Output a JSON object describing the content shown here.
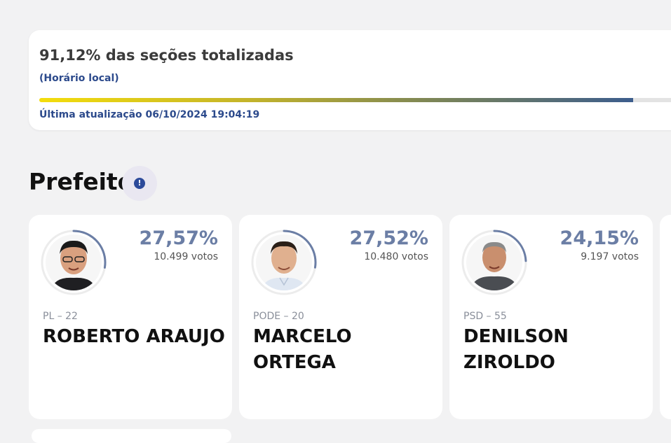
{
  "status": {
    "title": "91,12% das seções totalizadas",
    "subtitle": "(Horário local)",
    "progress": 0.9112,
    "updated": "Última atualização 06/10/2024 19:04:19"
  },
  "section": {
    "title": "Prefeito",
    "info_icon": "info-icon",
    "info_glyph": "!"
  },
  "candidates": [
    {
      "party": "PL – 22",
      "name": "ROBERTO ARAUJO",
      "percent": "27,57%",
      "votes": "10.499 votos",
      "share": 0.2757,
      "shirt": "#1f1f22",
      "hair": "#1a1a1a"
    },
    {
      "party": "PODE – 20",
      "name": "MARCELO ORTEGA",
      "percent": "27,52%",
      "votes": "10.480 votos",
      "share": 0.2752,
      "shirt": "#dfe7f2",
      "hair": "#2a1f18"
    },
    {
      "party": "PSD – 55",
      "name": "DENILSON ZIROLDO",
      "percent": "24,15%",
      "votes": "9.197 votos",
      "share": 0.2415,
      "shirt": "#4a4d52",
      "hair": "#8a8a8a"
    }
  ],
  "colors": {
    "accent": "#6b7ea5",
    "link": "#2c4a8c",
    "ring": "#6b7ea5"
  }
}
